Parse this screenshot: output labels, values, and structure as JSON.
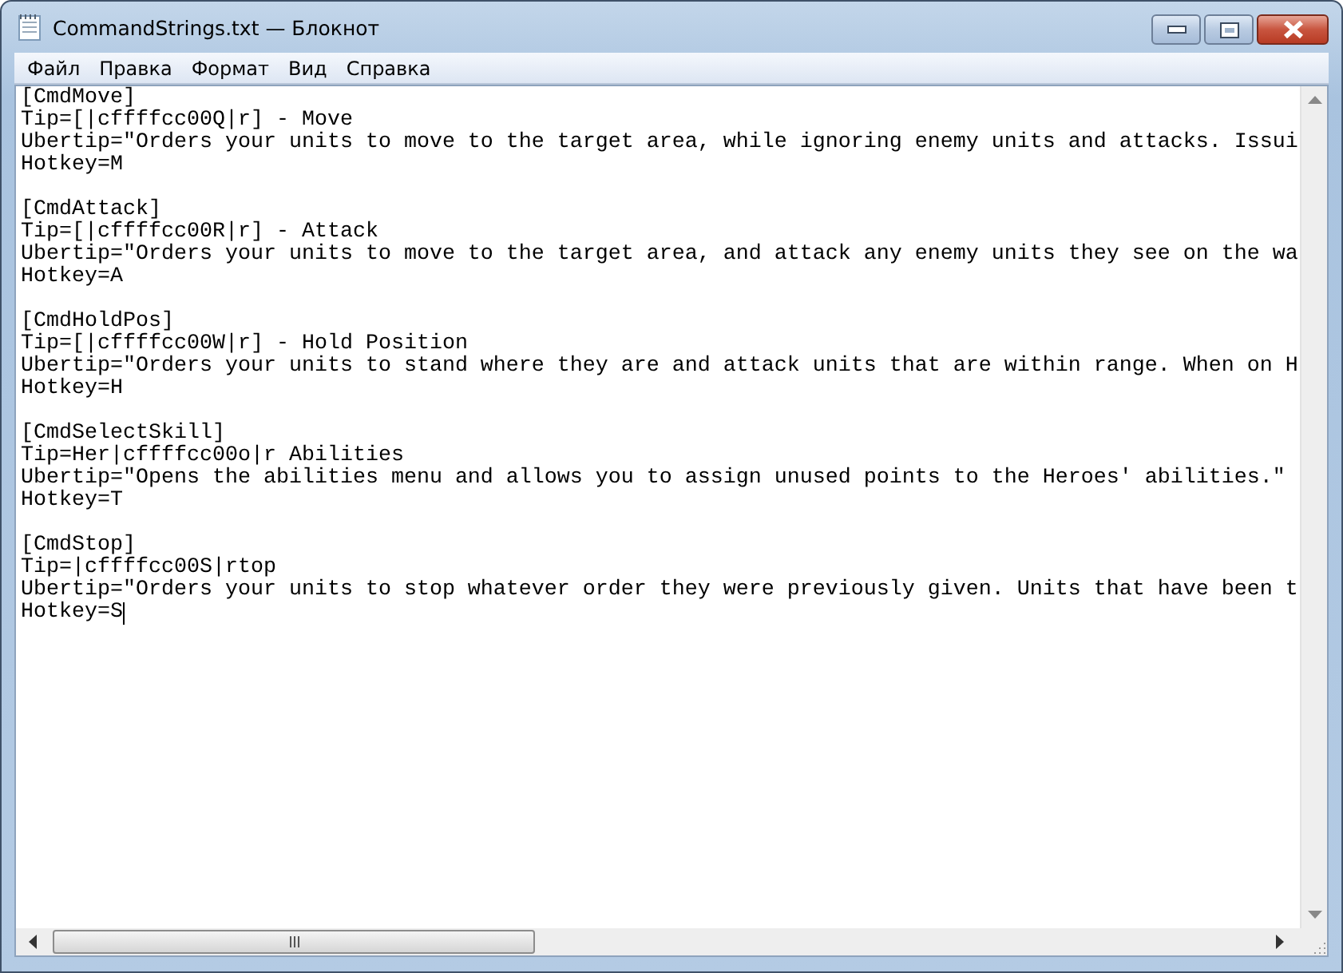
{
  "window": {
    "title": "CommandStrings.txt — Блокнот"
  },
  "menu": [
    "Файл",
    "Правка",
    "Формат",
    "Вид",
    "Справка"
  ],
  "document": {
    "blocks": [
      {
        "lines": [
          "[CmdMove]",
          "Tip=[|cffffcc00Q|r] - Move",
          "Ubertip=\"Orders your units to move to the target area, while ignoring enemy units and attacks. Issui",
          "Hotkey=M"
        ]
      },
      {
        "lines": [
          "[CmdAttack]",
          "Tip=[|cffffcc00R|r] - Attack",
          "Ubertip=\"Orders your units to move to the target area, and attack any enemy units they see on the wa",
          "Hotkey=A"
        ]
      },
      {
        "lines": [
          "[CmdHoldPos]",
          "Tip=[|cffffcc00W|r] - Hold Position",
          "Ubertip=\"Orders your units to stand where they are and attack units that are within range. When on H",
          "Hotkey=H"
        ]
      },
      {
        "lines": [
          "[CmdSelectSkill]",
          "Tip=Her|cffffcc00o|r Abilities",
          "Ubertip=\"Opens the abilities menu and allows you to assign unused points to the Heroes' abilities.\"",
          "Hotkey=T"
        ]
      },
      {
        "lines": [
          "[CmdStop]",
          "Tip=|cffffcc00S|rtop",
          "Ubertip=\"Orders your units to stop whatever order they were previously given. Units that have been t",
          "Hotkey=S"
        ]
      }
    ]
  }
}
